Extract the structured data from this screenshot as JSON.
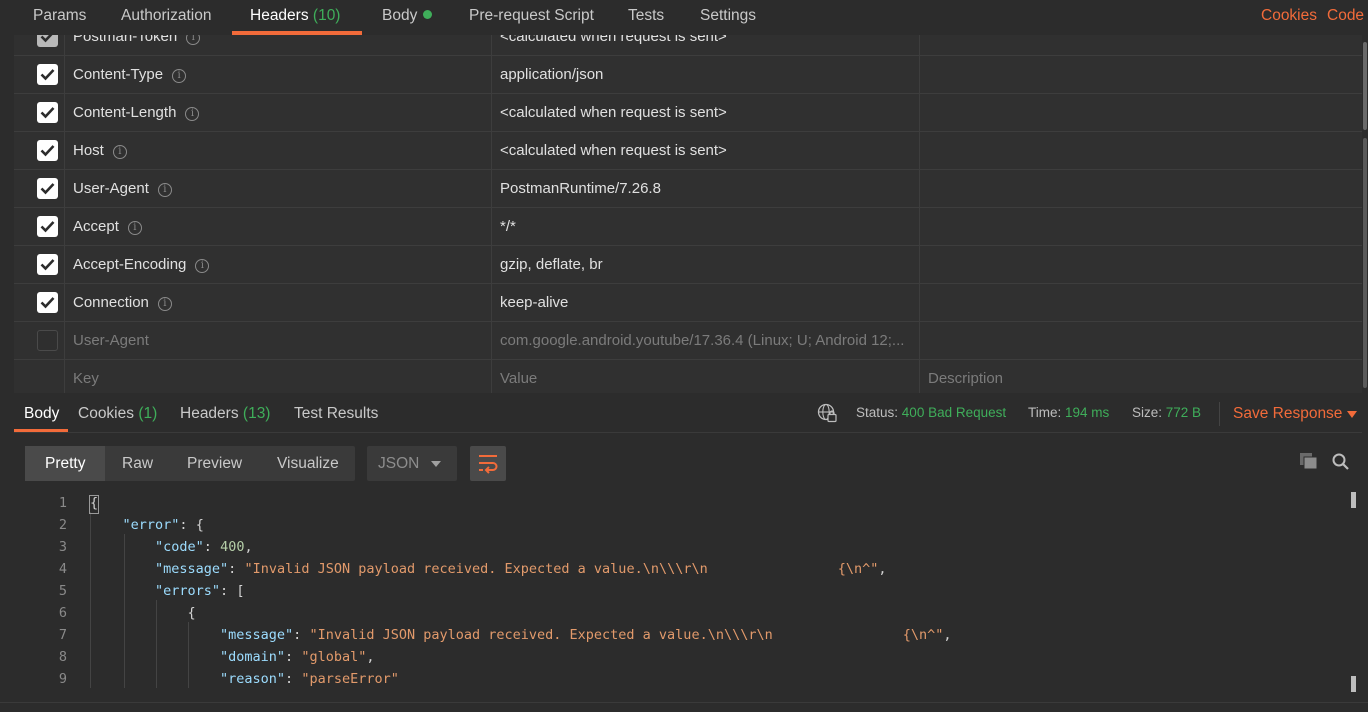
{
  "request_tabs": [
    {
      "label": "Params",
      "count": ""
    },
    {
      "label": "Authorization",
      "count": ""
    },
    {
      "label": "Headers",
      "count": "(10)"
    },
    {
      "label": "Body",
      "count": ""
    },
    {
      "label": "Pre-request Script",
      "count": ""
    },
    {
      "label": "Tests",
      "count": ""
    },
    {
      "label": "Settings",
      "count": ""
    }
  ],
  "top_links": {
    "cookies": "Cookies",
    "code": "Code"
  },
  "headers_table": {
    "rows": [
      {
        "key": "Postman-Token",
        "value": "<calculated when request is sent>",
        "checked": true
      },
      {
        "key": "Content-Type",
        "value": "application/json",
        "checked": true
      },
      {
        "key": "Content-Length",
        "value": "<calculated when request is sent>",
        "checked": true
      },
      {
        "key": "Host",
        "value": "<calculated when request is sent>",
        "checked": true
      },
      {
        "key": "User-Agent",
        "value": "PostmanRuntime/7.26.8",
        "checked": true
      },
      {
        "key": "Accept",
        "value": "*/*",
        "checked": true
      },
      {
        "key": "Accept-Encoding",
        "value": "gzip, deflate, br",
        "checked": true
      },
      {
        "key": "Connection",
        "value": "keep-alive",
        "checked": true
      },
      {
        "key": "User-Agent",
        "value": "com.google.android.youtube/17.36.4 (Linux; U; Android 12;...",
        "checked": false
      }
    ],
    "placeholders": {
      "key": "Key",
      "value": "Value",
      "description": "Description"
    }
  },
  "response_tabs": [
    {
      "label": "Body",
      "count": ""
    },
    {
      "label": "Cookies",
      "count": "(1)"
    },
    {
      "label": "Headers",
      "count": "(13)"
    },
    {
      "label": "Test Results",
      "count": ""
    }
  ],
  "response_meta": {
    "status_label": "Status:",
    "status_value": "400 Bad Request",
    "time_label": "Time:",
    "time_value": "194 ms",
    "size_label": "Size:",
    "size_value": "772 B",
    "save_response": "Save Response"
  },
  "format_buttons": [
    "Pretty",
    "Raw",
    "Preview",
    "Visualize"
  ],
  "language_select": "JSON",
  "code_lines": [
    {
      "num": "1",
      "text": "{"
    },
    {
      "num": "2",
      "text": "\"error\": {"
    },
    {
      "num": "3",
      "text": "\"code\": 400,"
    },
    {
      "num": "4",
      "text": "\"message\": \"Invalid JSON payload received. Expected a value.\\n\\\\\\r\\n                {\\n^\","
    },
    {
      "num": "5",
      "text": "\"errors\": ["
    },
    {
      "num": "6",
      "text": "{"
    },
    {
      "num": "7",
      "text": "\"message\": \"Invalid JSON payload received. Expected a value.\\n\\\\\\r\\n                {\\n^\","
    },
    {
      "num": "8",
      "text": "\"domain\": \"global\","
    },
    {
      "num": "9",
      "text": "\"reason\": \"parseError\""
    }
  ],
  "colors": {
    "accent": "#f26b3a",
    "success": "#3fae5a",
    "background": "#2c2c2c"
  }
}
